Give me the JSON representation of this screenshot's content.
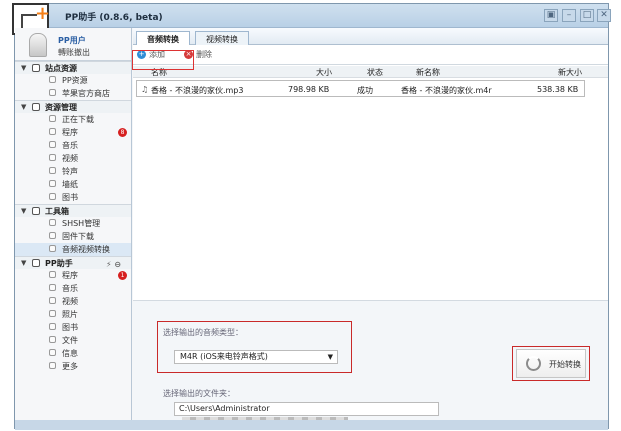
{
  "window": {
    "title": "PP助手 (0.8.6, beta)",
    "controls": [
      "▣",
      "–",
      "□",
      "✕"
    ]
  },
  "user": {
    "name": "PP用户",
    "logout": "轉账撤出"
  },
  "sidebar": {
    "sections": [
      {
        "label": "站点资源",
        "items": [
          "PP资源",
          "苹果官方商店"
        ]
      },
      {
        "label": "资源管理",
        "items": [
          "正在下载",
          "程序",
          "音乐",
          "视频",
          "铃声",
          "墙纸",
          "图书"
        ]
      },
      {
        "label": "工具箱",
        "items": [
          "SHSH管理",
          "固件下载",
          "音频视频转换"
        ]
      },
      {
        "label": "PP助手",
        "items": [
          "程序",
          "音乐",
          "视频",
          "照片",
          "图书",
          "文件",
          "信息",
          "更多"
        ]
      }
    ],
    "badges": {
      "program": "8",
      "pp_program": "1"
    }
  },
  "tabs": [
    "音频转换",
    "视频转换"
  ],
  "toolbar": {
    "add": "添加",
    "delete": "删除"
  },
  "table": {
    "headers": [
      "名称",
      "大小",
      "状态",
      "新名称",
      "新大小"
    ],
    "rows": [
      {
        "name": "香格 - 不浪漫的家伙.mp3",
        "size": "798.98 KB",
        "status": "成功",
        "new_name": "香格 - 不浪漫的家伙.m4r",
        "new_size": "538.38 KB"
      }
    ]
  },
  "convert": {
    "type_label": "选择输出的音频类型：",
    "type_value": "M4R (iOS来电铃声格式)",
    "folder_label": "选择输出的文件夹：",
    "folder_value": "C:\\Users\\Administrator",
    "button": "开始转换"
  }
}
